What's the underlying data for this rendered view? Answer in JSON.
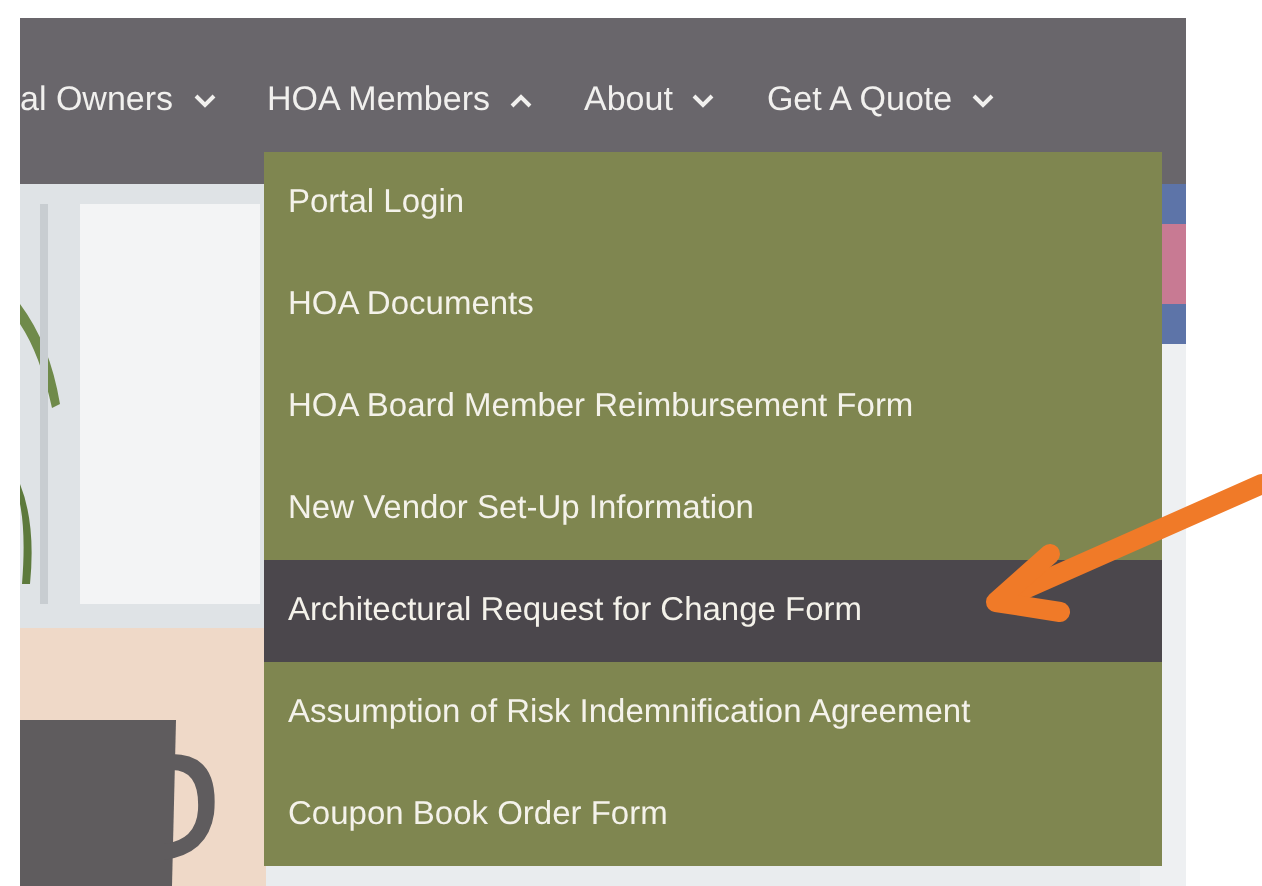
{
  "nav": [
    {
      "label": "al Owners",
      "expanded": false
    },
    {
      "label": "HOA Members",
      "expanded": true
    },
    {
      "label": "About",
      "expanded": false
    },
    {
      "label": "Get A Quote",
      "expanded": false
    }
  ],
  "dropdown": [
    {
      "label": "Portal Login",
      "selected": false
    },
    {
      "label": "HOA Documents",
      "selected": false
    },
    {
      "label": "HOA Board Member Reimbursement Form",
      "selected": false
    },
    {
      "label": "New Vendor Set-Up Information",
      "selected": false
    },
    {
      "label": "Architectural Request for Change Form",
      "selected": true
    },
    {
      "label": "Assumption of Risk Indemnification Agreement",
      "selected": false
    },
    {
      "label": "Coupon Book Order Form",
      "selected": false
    }
  ]
}
